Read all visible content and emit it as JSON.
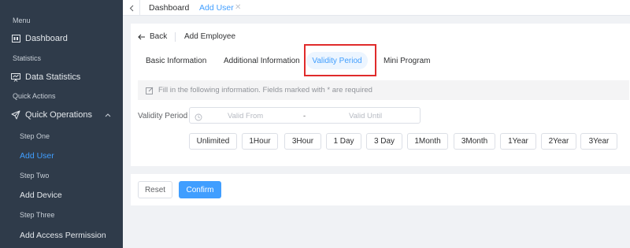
{
  "sidebar": {
    "menu_group": "Menu",
    "dashboard": "Dashboard",
    "statistics_group": "Statistics",
    "data_statistics": "Data Statistics",
    "quick_actions_group": "Quick Actions",
    "quick_operations": "Quick Operations",
    "step_one": "Step One",
    "add_user": "Add User",
    "step_two": "Step Two",
    "add_device": "Add Device",
    "step_three": "Step Three",
    "add_access_permission": "Add Access Permission"
  },
  "tabbar": {
    "tabs": [
      {
        "label": "Dashboard",
        "active": false
      },
      {
        "label": "Add User",
        "active": true
      }
    ]
  },
  "header": {
    "back_label": "Back",
    "title": "Add Employee"
  },
  "steps": {
    "tabs": [
      {
        "label": "Basic Information"
      },
      {
        "label": "Additional Information"
      },
      {
        "label": "Validity Period",
        "active": true
      },
      {
        "label": "Mini Program"
      }
    ]
  },
  "notice": "Fill in the following information. Fields marked with * are required",
  "validity": {
    "label": "Validity Period",
    "from_placeholder": "Valid From",
    "separator": "-",
    "until_placeholder": "Valid Until"
  },
  "quick_buttons": [
    "Unlimited",
    "1Hour",
    "3Hour",
    "1 Day",
    "3 Day",
    "1Month",
    "3Month",
    "1Year",
    "2Year",
    "3Year"
  ],
  "footer": {
    "reset_label": "Reset",
    "confirm_label": "Confirm"
  },
  "colors": {
    "sidebar_bg": "#2f3b4a",
    "accent": "#409eff",
    "highlight_border": "#e02b2b"
  }
}
